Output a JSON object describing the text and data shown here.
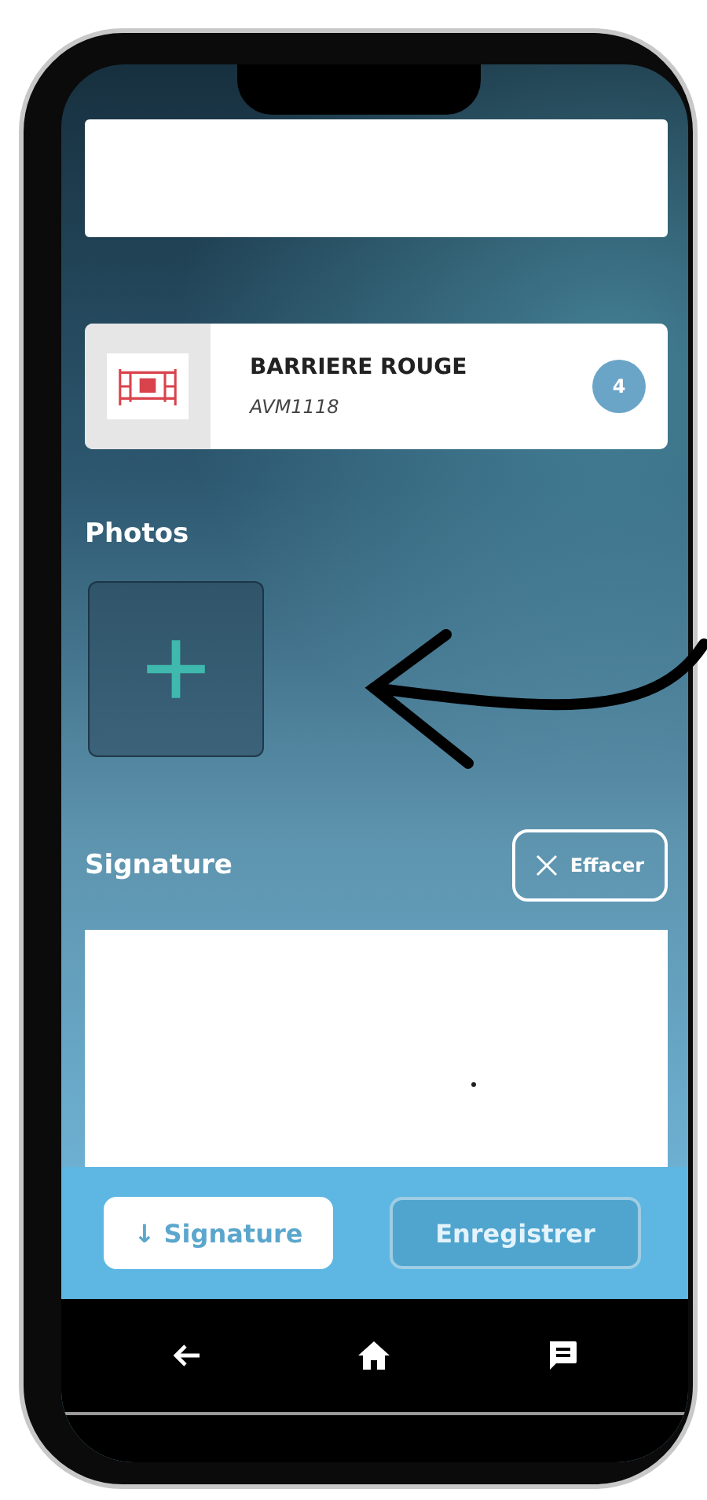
{
  "item": {
    "name": "BARRIERE ROUGE",
    "code": "AVM1118",
    "count": "4"
  },
  "photos": {
    "title": "Photos"
  },
  "signature": {
    "title": "Signature",
    "clear_button": "Effacer"
  },
  "actions": [
    {
      "label": "↓ Signature",
      "disabled": false
    },
    {
      "label": "Enregistrer",
      "disabled": true
    }
  ]
}
